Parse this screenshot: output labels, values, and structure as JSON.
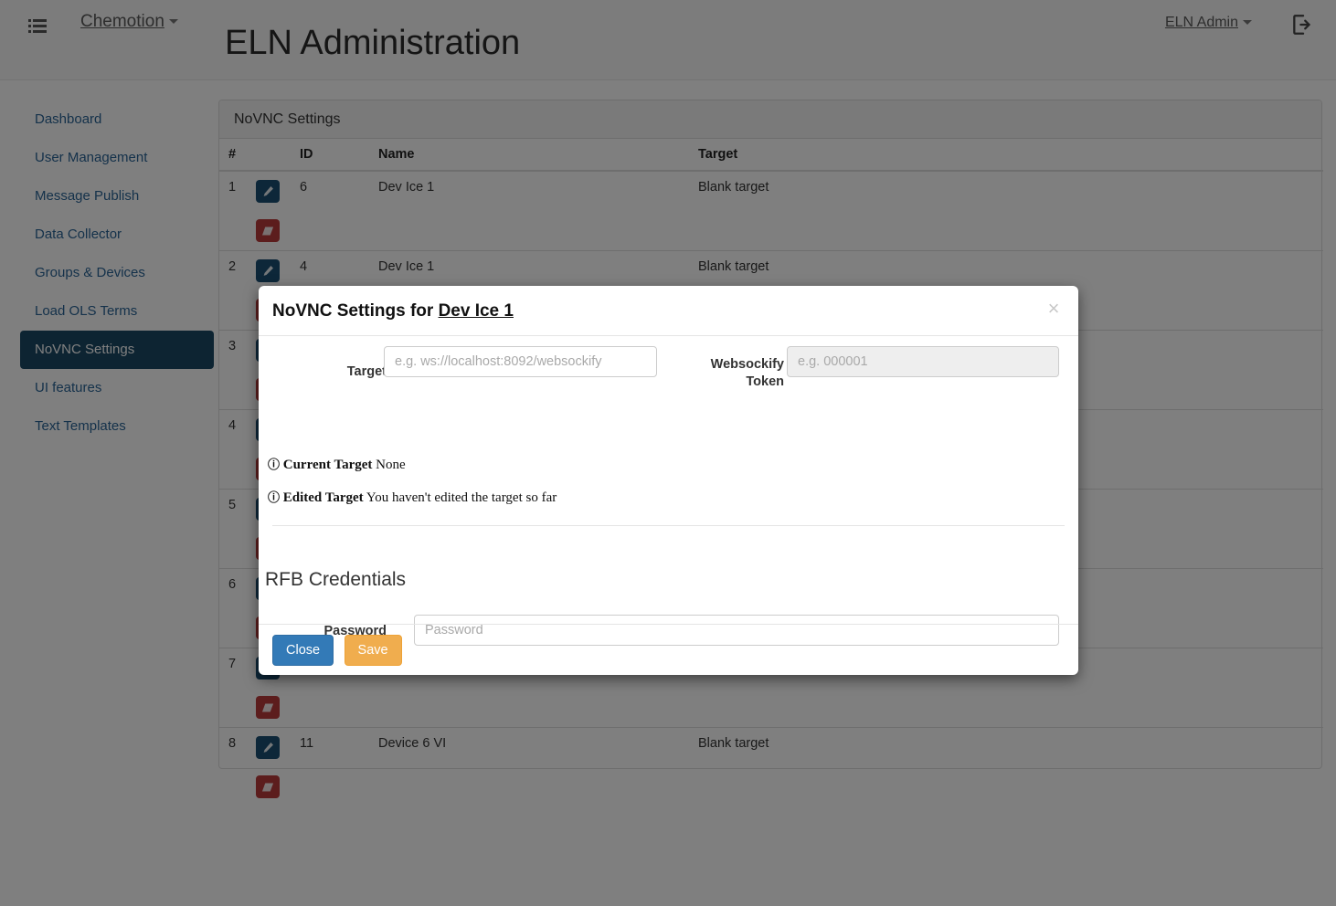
{
  "navbar": {
    "menu_icon": "list-icon",
    "brand": "Chemotion",
    "page_title": "ELN Administration",
    "user": "ELN Admin",
    "logout_icon": "sign-out-icon"
  },
  "sidebar": {
    "items": [
      {
        "label": "Dashboard",
        "active": false
      },
      {
        "label": "User Management",
        "active": false
      },
      {
        "label": "Message Publish",
        "active": false
      },
      {
        "label": "Data Collector",
        "active": false
      },
      {
        "label": "Groups & Devices",
        "active": false
      },
      {
        "label": "Load OLS Terms",
        "active": false
      },
      {
        "label": "NoVNC Settings",
        "active": true
      },
      {
        "label": "UI features",
        "active": false
      },
      {
        "label": "Text Templates",
        "active": false
      }
    ]
  },
  "panel": {
    "heading": "NoVNC Settings",
    "columns": [
      "#",
      "",
      "ID",
      "Name",
      "Target"
    ],
    "rows": [
      {
        "num": "1",
        "id": "6",
        "name": "Dev Ice 1",
        "target": "Blank target"
      },
      {
        "num": "2",
        "id": "4",
        "name": "Dev Ice 1",
        "target": "Blank target"
      },
      {
        "num": "3",
        "id": "",
        "name": "",
        "target": ""
      },
      {
        "num": "4",
        "id": "",
        "name": "",
        "target": ""
      },
      {
        "num": "5",
        "id": "",
        "name": "",
        "target": ""
      },
      {
        "num": "6",
        "id": "",
        "name": "",
        "target": ""
      },
      {
        "num": "7",
        "id": "",
        "name": "",
        "target": ""
      },
      {
        "num": "8",
        "id": "11",
        "name": "Device 6 VI",
        "target": "Blank target"
      }
    ],
    "edit_icon": "pencil-icon",
    "erase_icon": "eraser-icon"
  },
  "modal": {
    "title_prefix": "NoVNC Settings for ",
    "title_device": "Dev Ice 1",
    "close_icon": "close-icon",
    "target_label": "Target",
    "target_value": "",
    "target_placeholder": "e.g. ws://localhost:8092/websockify",
    "websockify_label_line1": "Websockify",
    "websockify_label_line2": "Token",
    "websockify_value": "",
    "websockify_placeholder": "e.g. 000001",
    "info_icon": "info-circle-icon",
    "current_target_label": "Current Target",
    "current_target_value": "None",
    "edited_target_label": "Edited Target",
    "edited_target_value": "You haven't edited the target so far",
    "section_title": "RFB Credentials",
    "password_label": "Password",
    "password_value": "",
    "password_placeholder": "Password",
    "close_button": "Close",
    "save_button": "Save"
  },
  "colors": {
    "sidebar_active": "#1b4965",
    "edit_button": "#1b4f72",
    "erase_button": "#b93b3b",
    "close_button": "#337ab7",
    "save_button": "#f0ad4e",
    "link": "#2a6496"
  }
}
